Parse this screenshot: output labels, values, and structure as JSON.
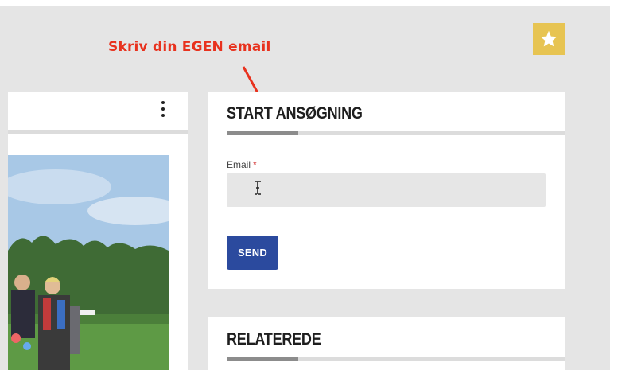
{
  "annotation": {
    "text": "Skriv din EGEN email"
  },
  "colors": {
    "annotation": "#e8321e",
    "accent_button": "#2b4a9e",
    "badge": "#e7c452"
  },
  "favorite_badge": {
    "icon": "star-icon"
  },
  "left_card": {
    "menu_icon": "kebab-menu-icon"
  },
  "form_card": {
    "title": "START ANSØGNING",
    "email_label": "Email",
    "required_mark": "*",
    "email_value": "",
    "send_label": "SEND"
  },
  "related_card": {
    "title": "RELATEREDE"
  }
}
